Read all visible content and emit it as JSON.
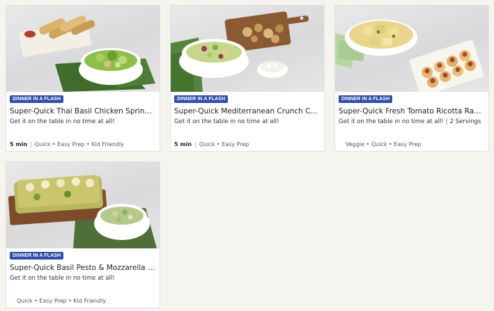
{
  "cards": [
    {
      "badge": "DINNER IN A FLASH",
      "title": "Super-Quick Thai Basil Chicken Spring ...",
      "description": "Get it on the table in no time at all!",
      "servings": "",
      "time": "5 min",
      "tags": "Quick • Easy Prep • Kid Friendly",
      "image_icon": "spring-rolls-and-salad"
    },
    {
      "badge": "DINNER IN A FLASH",
      "title": "Super-Quick Mediterranean Crunch Chic...",
      "description": "Get it on the table in no time at all!",
      "servings": "",
      "time": "5 min",
      "tags": "Quick • Easy Prep",
      "image_icon": "salad-and-chicken-board"
    },
    {
      "badge": "DINNER IN A FLASH",
      "title": "Super-Quick Fresh Tomato Ricotta Ravi...",
      "description": "Get it on the table in no time at all!",
      "servings": "2 Servings",
      "time": "",
      "tags": "Veggie • Quick • Easy Prep",
      "image_icon": "ravioli-and-bites"
    },
    {
      "badge": "DINNER IN A FLASH",
      "title": "Super-Quick Basil Pesto & Mozzarella Fo...",
      "description": "Get it on the table in no time at all!",
      "servings": "",
      "time": "",
      "tags": "Quick • Easy Prep • Kid Friendly",
      "image_icon": "focaccia-and-salad"
    }
  ],
  "colors": {
    "badge_bg": "#2f4fa8",
    "page_bg": "#f6f4ee",
    "card_bg": "#ffffff"
  }
}
